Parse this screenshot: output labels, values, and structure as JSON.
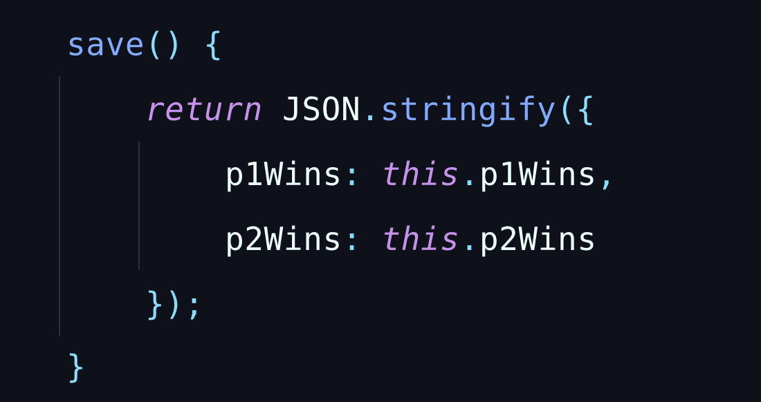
{
  "code": {
    "line1": {
      "method": "save",
      "parens": "()",
      "space": " ",
      "open_brace": "{"
    },
    "line2": {
      "keyword": "return",
      "space1": " ",
      "object": "JSON",
      "dot": ".",
      "method": "stringify",
      "paren_brace": "({"
    },
    "line3": {
      "key": "p1Wins",
      "colon": ":",
      "space": " ",
      "this": "this",
      "dot": ".",
      "prop": "p1Wins",
      "comma": ","
    },
    "line4": {
      "key": "p2Wins",
      "colon": ":",
      "space": " ",
      "this": "this",
      "dot": ".",
      "prop": "p2Wins"
    },
    "line5": {
      "close": "});"
    },
    "line6": {
      "close_brace": "}"
    }
  },
  "colors": {
    "background": "#0f111a",
    "function": "#82aaff",
    "punctuation": "#89ddff",
    "keyword": "#c792ea",
    "identifier": "#eeffff",
    "indent_guide": "#2b2f3f"
  }
}
